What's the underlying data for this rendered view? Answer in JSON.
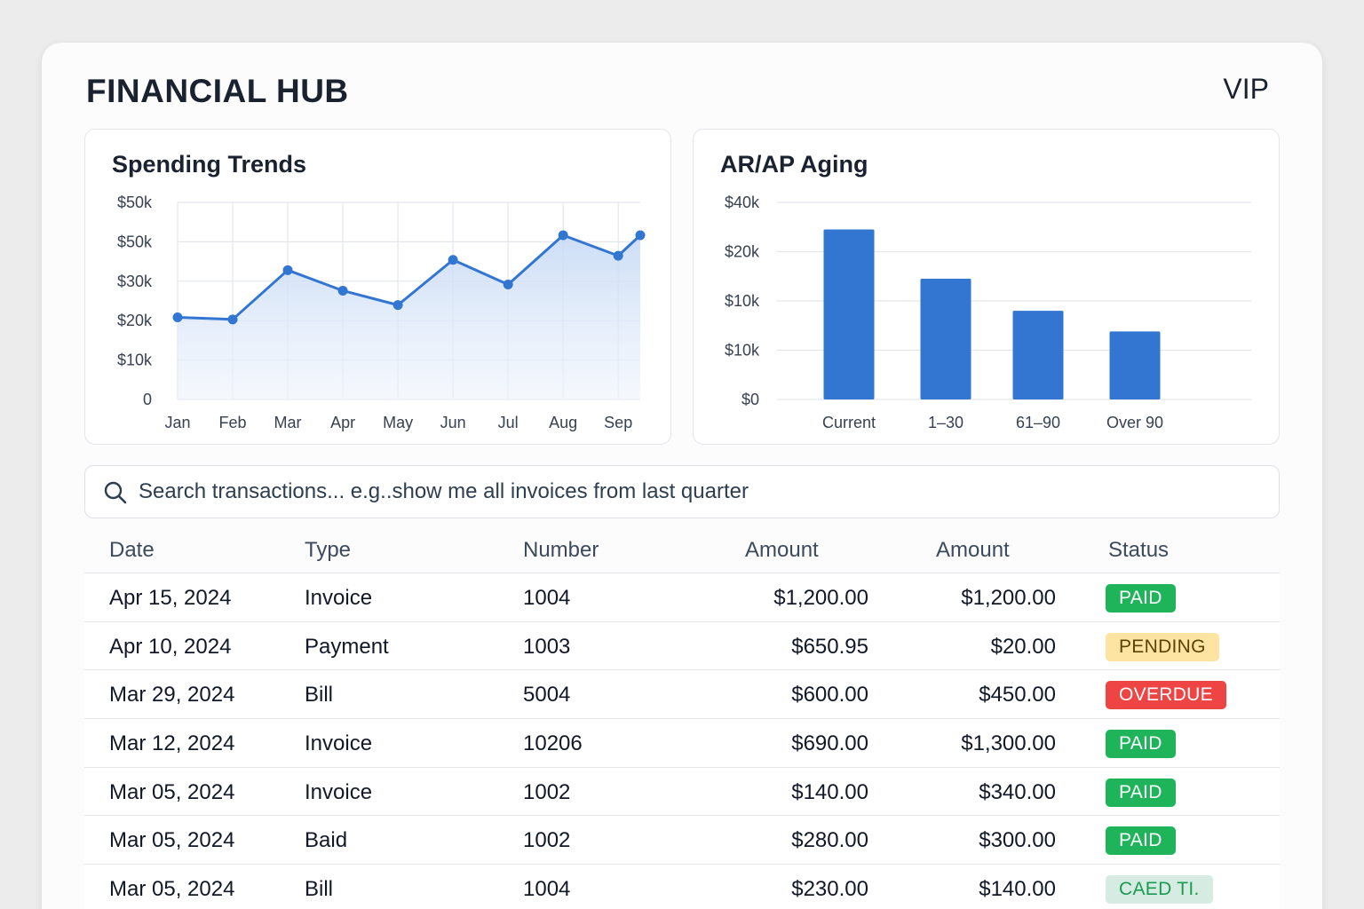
{
  "header": {
    "title": "FINANCIAL HUB",
    "badge": "VIP"
  },
  "colors": {
    "accent": "#3276d2",
    "paid": "#1fb35a",
    "pending_bg": "#fde4a3",
    "pending_text": "#5b4106",
    "overdue": "#ef4444",
    "muted_bg": "#d6ece2",
    "muted_text": "#1a9b53"
  },
  "chart_data": [
    {
      "type": "line",
      "title": "Spending Trends",
      "categories": [
        "Jan",
        "Feb",
        "Mar",
        "Apr",
        "May",
        "Jun",
        "Jul",
        "Aug",
        "Sep"
      ],
      "y_tick_labels": [
        "0",
        "$10k",
        "$20k",
        "$30k",
        "$50k",
        "$50k"
      ],
      "series": [
        {
          "values": [
            20000,
            19500,
            31500,
            26500,
            23000,
            34000,
            28000,
            40000,
            35000,
            40000
          ]
        }
      ],
      "ylim": [
        0,
        48000
      ],
      "grid": true,
      "area_fill": true
    },
    {
      "type": "bar",
      "title": "AR/AP Aging",
      "categories": [
        "Current",
        "1–30",
        "61–90",
        "Over 90"
      ],
      "y_tick_labels": [
        "$0",
        "$10k",
        "$10k",
        "$20k",
        "$40k"
      ],
      "values": [
        34500,
        24500,
        18000,
        13800
      ],
      "ylim": [
        0,
        40000
      ],
      "grid": true
    }
  ],
  "search": {
    "placeholder": "Search transactions... e.g..show me all invoices from last quarter",
    "icon": "search-icon"
  },
  "table": {
    "headers": [
      "Date",
      "Type",
      "Number",
      "Amount",
      "Amount",
      "Status"
    ],
    "rows": [
      {
        "date": "Apr 15, 2024",
        "type": "Invoice",
        "number": "1004",
        "amount1": "$1,200.00",
        "amount2": "$1,200.00",
        "status": "PAID",
        "status_kind": "paid"
      },
      {
        "date": "Apr 10, 2024",
        "type": "Payment",
        "number": "1003",
        "amount1": "$650.95",
        "amount2": "$20.00",
        "status": "PENDING",
        "status_kind": "pending"
      },
      {
        "date": "Mar 29, 2024",
        "type": "Bill",
        "number": "5004",
        "amount1": "$600.00",
        "amount2": "$450.00",
        "status": "OVERDUE",
        "status_kind": "overdue"
      },
      {
        "date": "Mar 12, 2024",
        "type": "Invoice",
        "number": "10206",
        "amount1": "$690.00",
        "amount2": "$1,300.00",
        "status": "PAID",
        "status_kind": "paid"
      },
      {
        "date": "Mar 05, 2024",
        "type": "Invoice",
        "number": "1002",
        "amount1": "$140.00",
        "amount2": "$340.00",
        "status": "PAID",
        "status_kind": "paid"
      },
      {
        "date": "Mar 05, 2024",
        "type": "Baid",
        "number": "1002",
        "amount1": "$280.00",
        "amount2": "$300.00",
        "status": "PAID",
        "status_kind": "paid"
      },
      {
        "date": "Mar 05, 2024",
        "type": "Bill",
        "number": "1004",
        "amount1": "$230.00",
        "amount2": "$140.00",
        "status": "CAED TI.",
        "status_kind": "muted"
      }
    ]
  }
}
